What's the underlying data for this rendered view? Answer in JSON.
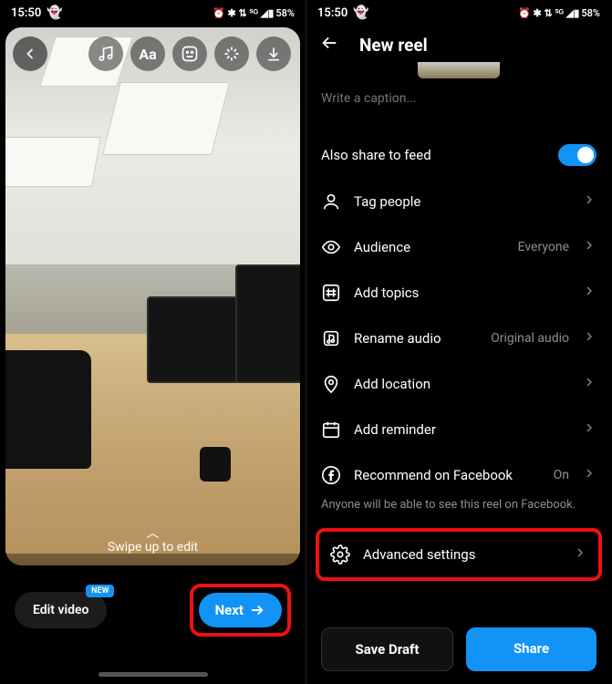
{
  "status": {
    "time": "15:50",
    "battery": "58%",
    "indicators": "⏰ ✱ ⇅ ⁵ᴳ ◢▮"
  },
  "left": {
    "swipe_hint": "Swipe up to edit",
    "edit_video": "Edit video",
    "new_badge": "NEW",
    "next": "Next",
    "tools": {
      "music": "music-icon",
      "text": "Aa",
      "sticker": "sticker-icon",
      "effects": "effects-icon",
      "download": "download-icon"
    }
  },
  "right": {
    "title": "New reel",
    "caption_placeholder": "Write a caption...",
    "share_feed": "Also share to feed",
    "rows": {
      "tag_people": "Tag people",
      "audience": "Audience",
      "audience_value": "Everyone",
      "add_topics": "Add topics",
      "rename_audio": "Rename audio",
      "rename_audio_value": "Original audio",
      "add_location": "Add location",
      "add_reminder": "Add reminder",
      "recommend_fb": "Recommend on Facebook",
      "recommend_fb_value": "On",
      "recommend_fb_sub": "Anyone will be able to see this reel on Facebook.",
      "advanced": "Advanced settings"
    },
    "actions": {
      "save_draft": "Save Draft",
      "share": "Share"
    }
  }
}
